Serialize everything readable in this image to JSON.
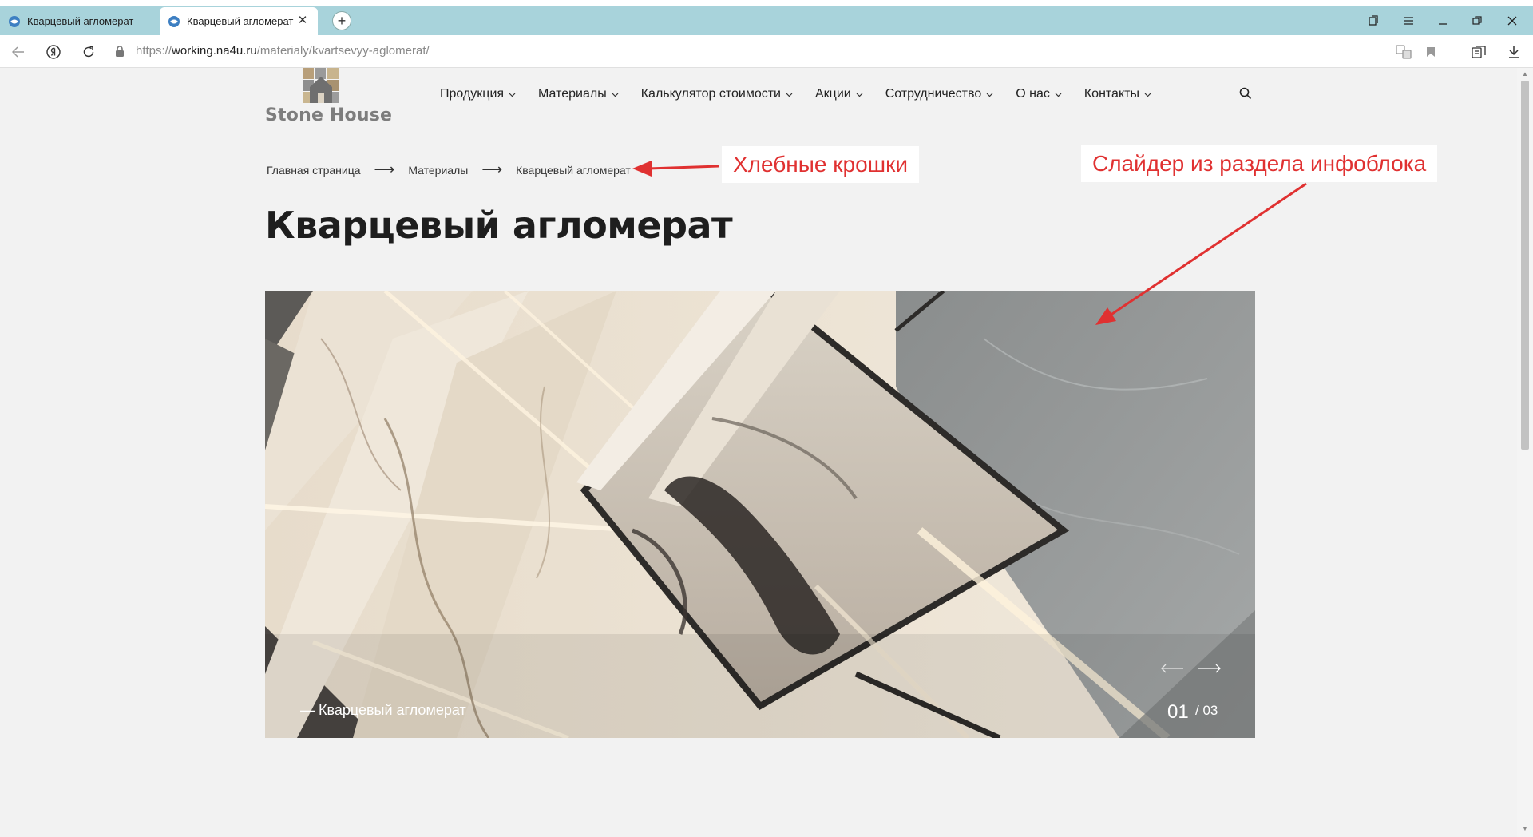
{
  "browser": {
    "tabs": [
      {
        "title": "Кварцевый агломерат",
        "active": false
      },
      {
        "title": "Кварцевый агломерат",
        "active": true
      }
    ],
    "url_prefix": "https://",
    "url_host": "working.na4u.ru",
    "url_path": "/materialy/kvartsevyy-aglomerat/",
    "tab_color": "#a8d3db"
  },
  "header": {
    "logo_text": "Stone House",
    "nav": [
      {
        "label": "Продукция"
      },
      {
        "label": "Материалы"
      },
      {
        "label": "Калькулятор стоимости"
      },
      {
        "label": "Акции"
      },
      {
        "label": "Сотрудничество"
      },
      {
        "label": "О нас"
      },
      {
        "label": "Контакты"
      }
    ]
  },
  "breadcrumb": [
    "Главная страница",
    "Материалы",
    "Кварцевый агломерат"
  ],
  "breadcrumb_separator": "⟶",
  "page_title": "Кварцевый агломерат",
  "slider": {
    "caption": "— Кварцевый агломерат",
    "current": "01",
    "total": "/ 03",
    "prev_arrow": "⟵",
    "next_arrow": "⟶"
  },
  "annotations": {
    "breadcrumbs_label": "Хлебные крошки",
    "slider_label": "Слайдер из раздела инфоблока",
    "color": "#e03131"
  }
}
